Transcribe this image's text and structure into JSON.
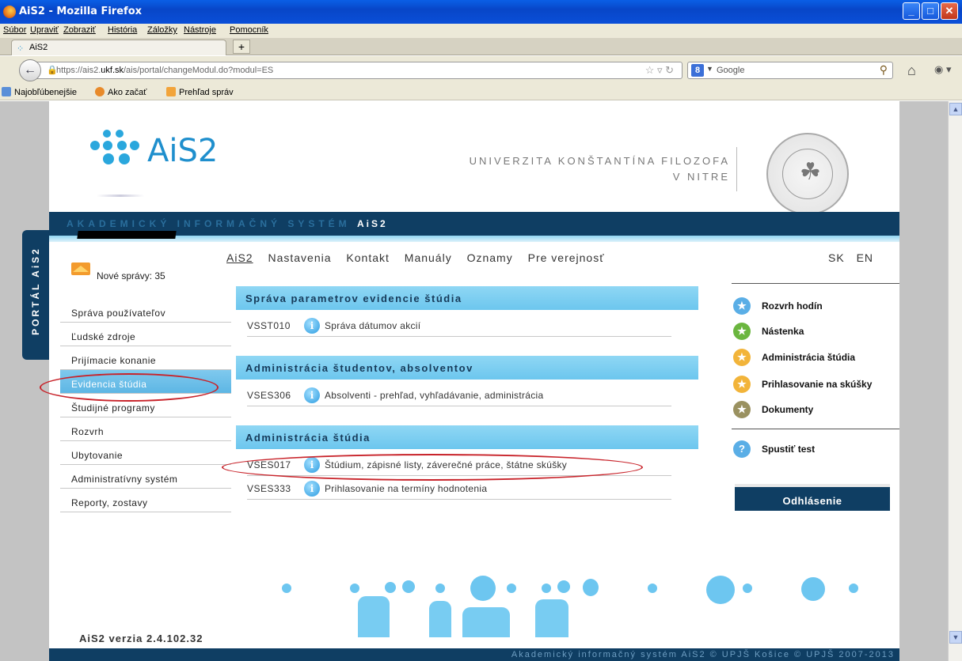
{
  "window": {
    "title": "AiS2 - Mozilla Firefox"
  },
  "menu": [
    "Súbor",
    "Upraviť",
    "Zobraziť",
    "História",
    "Záložky",
    "Nástroje",
    "Pomocník"
  ],
  "tab": {
    "label": "AiS2",
    "newtab": "+"
  },
  "address": {
    "prefix": "https://ais2.",
    "host": "ukf.sk",
    "suffix": "/ais/portal/changeModul.do?modul=ES"
  },
  "search": {
    "placeholder": "Google"
  },
  "bookmarks": [
    "Najobľúbenejšie",
    "Ako začať",
    "Prehľad správ"
  ],
  "portal_tab": "PORTÁL AiS2",
  "header": {
    "logo": "AiS2",
    "university_line1": "UNIVERZITA KONŠTANTÍNA FILOZOFA",
    "university_line2": "V NITRE",
    "seal_text": "UNIVERZITA KONŠTANTÍNA FILOZOFA V NITRE",
    "system_name_a": "AKADEMICKÝ INFORMAČNÝ SYSTÉM",
    "system_name_b": "AiS2"
  },
  "messages": "Nové správy: 35",
  "left_menu": [
    "Správa používateľov",
    "Ľudské zdroje",
    "Prijímacie konanie",
    "Evidencia štúdia",
    "Študijné programy",
    "Rozvrh",
    "Ubytovanie",
    "Administratívny systém",
    "Reporty, zostavy"
  ],
  "version": "AiS2 verzia 2.4.102.32",
  "top_nav": [
    "AiS2",
    "Nastavenia",
    "Kontakt",
    "Manuály",
    "Oznamy",
    "Pre verejnosť"
  ],
  "languages": [
    "SK",
    "EN"
  ],
  "sections": [
    {
      "title": "Správa parametrov evidencie štúdia",
      "apps": [
        {
          "code": "VSST010",
          "name": "Správa dátumov akcií"
        }
      ]
    },
    {
      "title": "Administrácia študentov, absolventov",
      "apps": [
        {
          "code": "VSES306",
          "name": "Absolventi - prehľad, vyhľadávanie, administrácia"
        }
      ]
    },
    {
      "title": "Administrácia štúdia",
      "apps": [
        {
          "code": "VSES017",
          "name": "Štúdium, zápisné listy, záverečné práce, štátne skúšky"
        },
        {
          "code": "VSES333",
          "name": "Prihlasovanie na termíny hodnotenia"
        }
      ]
    }
  ],
  "right_links": [
    {
      "label": "Rozvrh hodín",
      "color": "#5aaee6"
    },
    {
      "label": "Nástenka",
      "color": "#6bb63f"
    },
    {
      "label": "Administrácia štúdia",
      "color": "#f2b43a"
    },
    {
      "label": "Prihlasovanie na skúšky",
      "color": "#f2b43a"
    },
    {
      "label": "Dokumenty",
      "color": "#9a9160"
    }
  ],
  "test_link": "Spustiť test",
  "logout": "Odhlásenie",
  "footer": "Akademický informačný systém AiS2 © UPJŠ Košice © UPJŠ 2007-2013"
}
